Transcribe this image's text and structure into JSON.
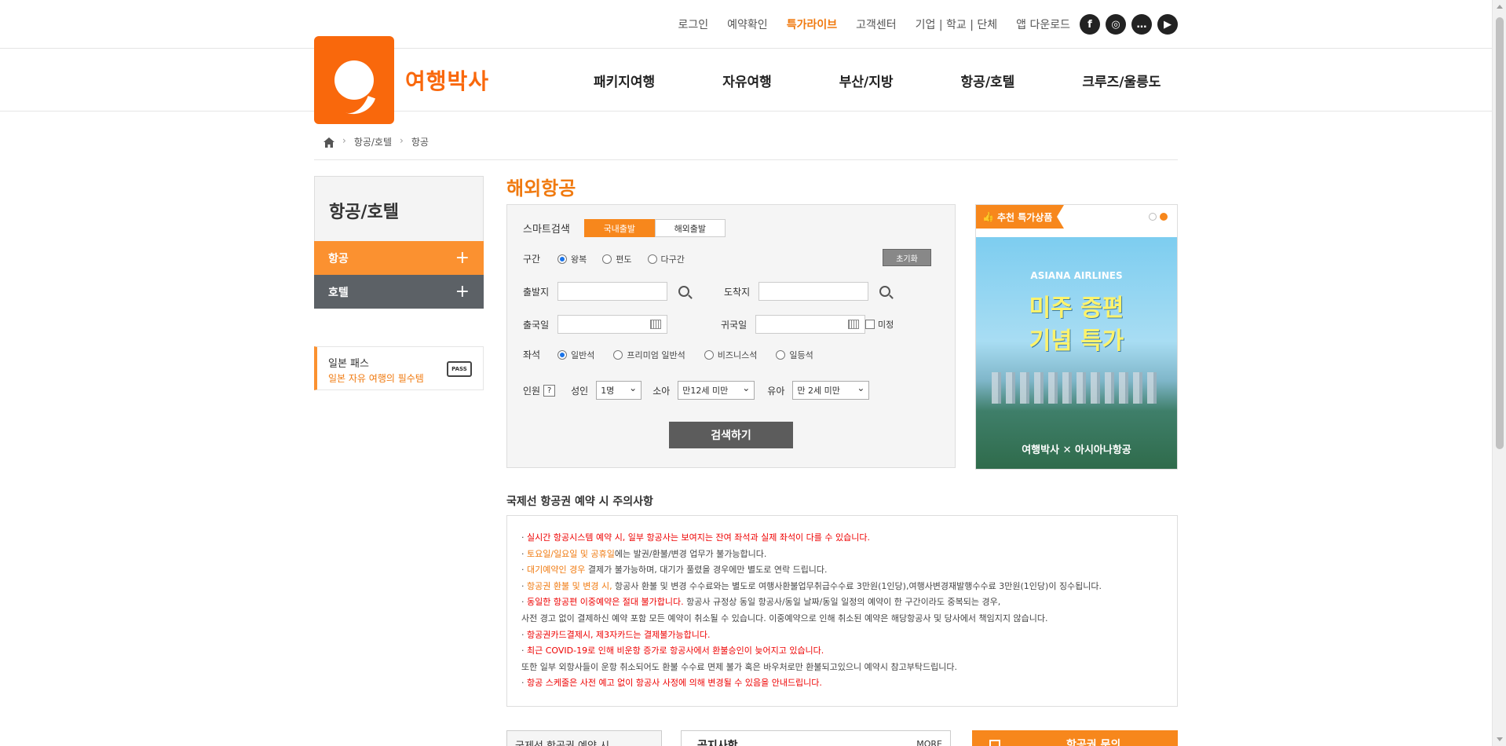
{
  "top_links": [
    "로그인",
    "예약확인",
    "특가라이브",
    "고객센터",
    "기업 | 학교 | 단체",
    "앱 다운로드"
  ],
  "sns_icons": [
    "facebook-icon",
    "instagram-icon",
    "talk-icon",
    "youtube-icon"
  ],
  "logo": {
    "text": "여행박사",
    "color": "#f9680c"
  },
  "gnb": [
    "패키지여행",
    "자유여행",
    "부산/지방",
    "항공/호텔",
    "크루즈/울릉도"
  ],
  "breadcrumb": [
    "항공/호텔",
    "항공"
  ],
  "lnb": {
    "title": "항공/호텔",
    "items": [
      {
        "label": "항공",
        "active": true
      },
      {
        "label": "호텔",
        "active": false
      }
    ],
    "pass": {
      "title": "일본 패스",
      "sub": "일본 자유 여행의 필수템",
      "icon_text": "PASS"
    }
  },
  "main": {
    "title": "해외항공",
    "smart_search_label": "스마트검색",
    "departure_tabs": [
      "국내출발",
      "해외출발"
    ],
    "route_label": "구간",
    "route_options": [
      "왕복",
      "편도",
      "다구간"
    ],
    "reset_label": "초기화",
    "from_label": "출발지",
    "to_label": "도착지",
    "depart_date_label": "출국일",
    "return_date_label": "귀국일",
    "undecided_label": "미정",
    "seat_label": "좌석",
    "seat_options": [
      "일반석",
      "프리미엄 일반석",
      "비즈니스석",
      "일등석"
    ],
    "pax_label": "인원",
    "adult_label": "성인",
    "adult_value": "1명",
    "child_label": "소아",
    "child_value": "만12세 미만",
    "infant_label": "유아",
    "infant_value": "만 2세 미만",
    "search_button": "검색하기"
  },
  "banner": {
    "tag": "추천 특가상품",
    "airline": "ASIANA AIRLINES",
    "headline_1": "미주 증편",
    "headline_2": "기념 특가",
    "footer": "여행박사 ✕ 아시아나항공"
  },
  "notes": {
    "title": "국제선 항공권 예약 시 주의사항",
    "items": [
      {
        "hl": "실시간 항공시스템 예약 시, 일부 항공사는 보여지는 잔여 좌석과 실제 좌석이 다를 수 있습니다.",
        "rest": ""
      },
      {
        "hl": "토요일/일요일 및 공휴일",
        "rest": "에는 발권/환불/변경 업무가 불가능합니다."
      },
      {
        "hl": "대기예약인 경우",
        "rest": " 결제가 불가능하며, 대기가 풀렸을 경우에만 별도로 연락 드립니다."
      },
      {
        "hl": "항공권 환불 및 변경 시,",
        "rest": " 항공사 환불 및 변경 수수료와는 별도로 여행사환불업무취급수수료 3만원(1인당),여행사변경재발행수수료 3만원(1인당)이 징수됩니다."
      },
      {
        "hl": "동일한 항공편 이중예약은 절대 불가합니다.",
        "rest": " 항공사 규정상 동일 항공사/동일 날짜/동일 일정의 예약이 한 구간이라도 중복되는 경우,",
        "sub": "사전 경고 없이 결제하신 예약 포함 모든 예약이 취소될 수 있습니다. 이중예약으로 인해 취소된 예약은 해당항공사 및 당사에서 책임지지 않습니다."
      },
      {
        "hl": "항공권카드결제시, 제3자카드는 결제불가능합니다.",
        "rest": ""
      },
      {
        "hl": "최근 COVID-19로 인해 비운항 증가로 항공사에서 환불승인이 늦어지고 있습니다.",
        "rest": "",
        "sub": "또한 일부 외항사들이 운항 취소되어도 환불 수수료 면제 불가 혹은 바우처로만 환불되고있으니 예약시 참고부탁드립니다."
      },
      {
        "hl": "항공 스케줄은 사전 예고 없이 항공사 사정에 의해 변경될 수 있음을 안내드립니다.",
        "rest": ""
      }
    ]
  },
  "bottom": {
    "box1": "국제선 항공권 예약 시",
    "box2": "공지사항",
    "box2_more": "MORE",
    "box3": "항공권 문의"
  }
}
